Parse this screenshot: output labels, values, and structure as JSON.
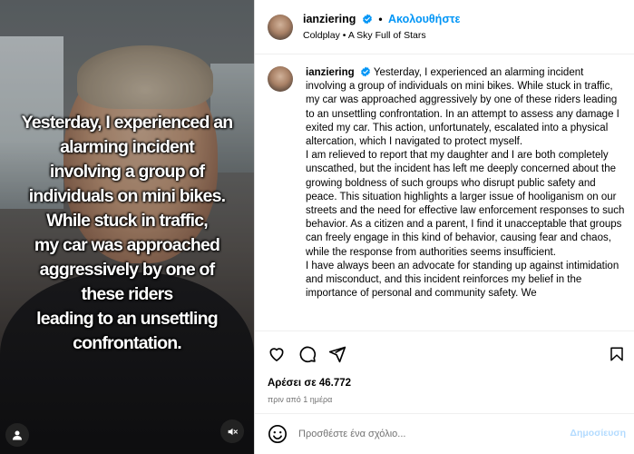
{
  "video": {
    "caption_lines": [
      "Yesterday, I experienced an",
      "alarming incident",
      "involving a group of",
      "individuals on mini bikes.",
      "While stuck in traffic,",
      "my car was approached",
      "aggressively by one of",
      "these riders",
      "leading to an unsettling",
      "confrontation."
    ],
    "mute_icon": "speaker-muted-icon",
    "tag_icon": "user-tag-icon"
  },
  "header": {
    "username": "ianziering",
    "follow_label": "Ακολουθήστε",
    "separator": "•",
    "music_artist": "Coldplay",
    "music_title": "A Sky Full of Stars"
  },
  "post": {
    "username": "ianziering",
    "paragraphs": [
      "Yesterday, I experienced an alarming incident involving a group of individuals on mini bikes. While stuck in traffic, my car was approached aggressively by one of these riders leading to an unsettling confrontation. In an attempt to assess any damage I exited my car. This action, unfortunately, escalated into a physical altercation, which I navigated to protect myself.",
      "I am relieved to report that my daughter and I are both completely unscathed, but the incident has left me deeply concerned about the growing boldness of such groups who disrupt public safety and peace. This situation highlights a larger issue of hooliganism on our streets and the need for effective law enforcement responses to such behavior. As a citizen and a parent, I find it unacceptable that groups can freely engage in this kind of behavior, causing fear and chaos, while the response from authorities seems insufficient.",
      "I have always been an advocate for standing up against intimidation and misconduct, and this incident reinforces my belief in the importance of personal and community safety. We"
    ]
  },
  "actions": {
    "likes_label": "Αρέσει σε 46.772",
    "time_ago": "πριν από 1 ημέρα"
  },
  "composer": {
    "placeholder": "Προσθέστε ένα σχόλιο...",
    "post_label": "Δημοσίευση"
  },
  "colors": {
    "accent": "#0095f6",
    "verified": "#0095f6",
    "post_disabled": "#b3dbff",
    "muted_text": "#737373"
  }
}
